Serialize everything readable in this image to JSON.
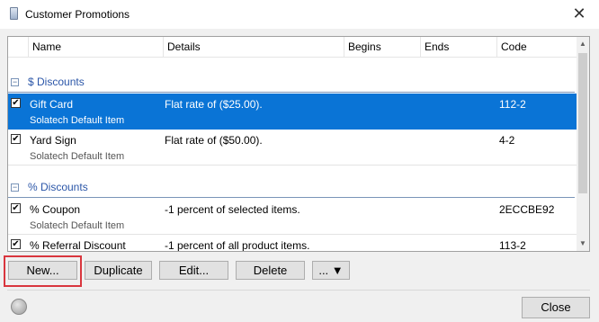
{
  "window": {
    "title": "Customer Promotions",
    "close_glyph": "✕"
  },
  "columns": [
    "Name",
    "Details",
    "Begins",
    "Ends",
    "Code"
  ],
  "groups": [
    {
      "title": "$ Discounts",
      "toggle": "−",
      "items": [
        {
          "name": "Gift Card",
          "details": "Flat rate of ($25.00).",
          "begins": "",
          "ends": "",
          "code": "112-2",
          "sub": "Solatech Default Item",
          "checked": "✔",
          "selected": true
        },
        {
          "name": "Yard Sign",
          "details": "Flat rate of ($50.00).",
          "begins": "",
          "ends": "",
          "code": "4-2",
          "sub": "Solatech Default Item",
          "checked": "✔",
          "selected": false
        }
      ]
    },
    {
      "title": "% Discounts",
      "toggle": "−",
      "items": [
        {
          "name": "% Coupon",
          "details": "-1 percent of selected items.",
          "begins": "",
          "ends": "",
          "code": "2ECCBE92",
          "sub": "Solatech Default Item",
          "checked": "✔",
          "selected": false
        },
        {
          "name": "% Referral Discount",
          "details": "-1 percent of all product items.",
          "begins": "",
          "ends": "",
          "code": "113-2",
          "sub": "",
          "checked": "✔",
          "selected": false
        }
      ]
    }
  ],
  "scrollbar": {
    "up": "▲",
    "down": "▼"
  },
  "buttons": {
    "new": "New...",
    "duplicate": "Duplicate",
    "edit": "Edit...",
    "delete": "Delete",
    "more": "... ▼",
    "close": "Close"
  },
  "colors": {
    "selection": "#0a74d6",
    "group_title": "#2b56a8",
    "highlight": "#d9363e"
  }
}
